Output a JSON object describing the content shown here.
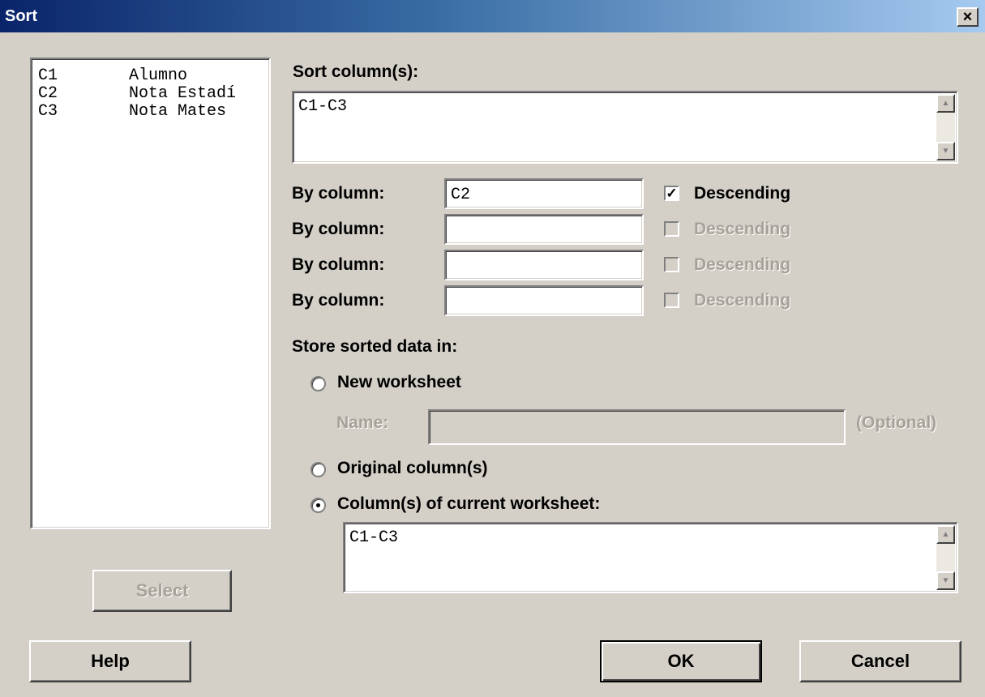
{
  "window": {
    "title": "Sort",
    "close_label": "×"
  },
  "columns_list": [
    {
      "id": "C1",
      "name": "Alumno"
    },
    {
      "id": "C2",
      "name": "Nota Estadí"
    },
    {
      "id": "C3",
      "name": "Nota Mates"
    }
  ],
  "select_button": "Select",
  "sort_columns": {
    "label": "Sort column(s):",
    "value": "C1-C3"
  },
  "by_columns": [
    {
      "label": "By column:",
      "value": "C2",
      "descending_label": "Descending",
      "descending_checked": true,
      "enabled": true
    },
    {
      "label": "By column:",
      "value": "",
      "descending_label": "Descending",
      "descending_checked": false,
      "enabled": false
    },
    {
      "label": "By column:",
      "value": "",
      "descending_label": "Descending",
      "descending_checked": false,
      "enabled": false
    },
    {
      "label": "By column:",
      "value": "",
      "descending_label": "Descending",
      "descending_checked": false,
      "enabled": false
    }
  ],
  "store": {
    "label": "Store sorted data in:",
    "new_worksheet": "New worksheet",
    "name_label": "Name:",
    "name_value": "",
    "optional_label": "(Optional)",
    "original_columns": "Original column(s)",
    "current_worksheet": "Column(s) of current worksheet:",
    "selected": "current_worksheet",
    "current_worksheet_value": "C1-C3"
  },
  "buttons": {
    "help": "Help",
    "ok": "OK",
    "cancel": "Cancel"
  },
  "colors": {
    "title_start": "#0a246a",
    "title_end": "#a6caf0",
    "face": "#d4d0c8",
    "disabled_text": "#a6a29a"
  }
}
